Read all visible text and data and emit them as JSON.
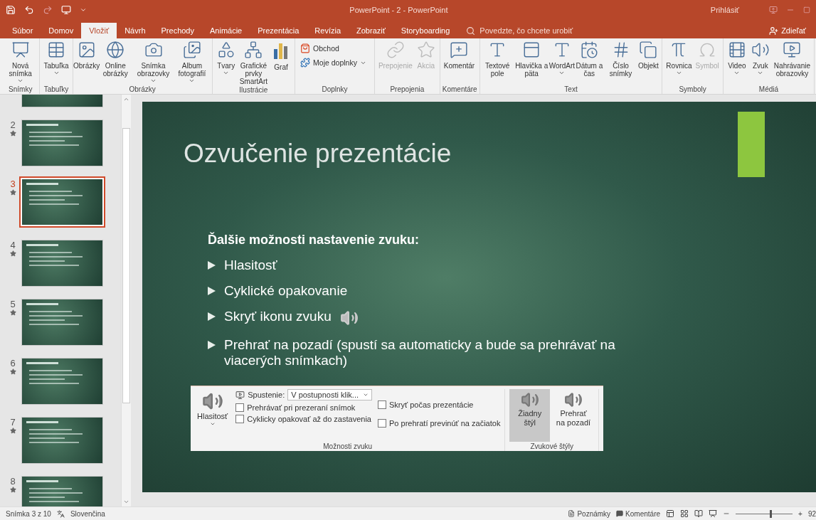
{
  "window": {
    "title": "PowerPoint - 2  -  PowerPoint",
    "sign_in": "Prihlásiť"
  },
  "tabs": [
    {
      "label": "Súbor",
      "selected": false
    },
    {
      "label": "Domov",
      "selected": false
    },
    {
      "label": "Vložiť",
      "selected": true
    },
    {
      "label": "Návrh",
      "selected": false
    },
    {
      "label": "Prechody",
      "selected": false
    },
    {
      "label": "Animácie",
      "selected": false
    },
    {
      "label": "Prezentácia",
      "selected": false
    },
    {
      "label": "Revízia",
      "selected": false
    },
    {
      "label": "Zobraziť",
      "selected": false
    },
    {
      "label": "Storyboarding",
      "selected": false
    }
  ],
  "tell_me": {
    "placeholder": "Povedzte, čo chcete urobiť"
  },
  "share": "Zdieľať",
  "ribbon": [
    {
      "label": "Snímky",
      "buttons": [
        {
          "label": "Nová snímka",
          "kind": "large",
          "dropdown": true,
          "disabled": false
        }
      ]
    },
    {
      "label": "Tabuľky",
      "buttons": [
        {
          "label": "Tabuľka",
          "kind": "large",
          "dropdown": true,
          "disabled": false
        }
      ]
    },
    {
      "label": "Obrázky",
      "buttons": [
        {
          "label": "Obrázky",
          "kind": "large",
          "dropdown": false,
          "disabled": false
        },
        {
          "label": "Online obrázky",
          "kind": "large",
          "dropdown": false,
          "disabled": false
        },
        {
          "label": "Snímka obrazovky",
          "kind": "large",
          "dropdown": true,
          "disabled": false
        },
        {
          "label": "Album fotografií",
          "kind": "large",
          "dropdown": true,
          "disabled": false
        }
      ]
    },
    {
      "label": "Ilustrácie",
      "buttons": [
        {
          "label": "Tvary",
          "kind": "large",
          "dropdown": true,
          "disabled": false
        },
        {
          "label": "Grafické prvky SmartArt",
          "kind": "large",
          "dropdown": false,
          "disabled": false
        },
        {
          "label": "Graf",
          "kind": "large",
          "dropdown": false,
          "disabled": false
        }
      ]
    },
    {
      "label": "Doplnky",
      "buttons": [
        {
          "label": "Obchod",
          "kind": "small",
          "dropdown": false,
          "disabled": false
        },
        {
          "label": "Moje doplnky",
          "kind": "small",
          "dropdown": true,
          "disabled": false
        }
      ]
    },
    {
      "label": "Prepojenia",
      "buttons": [
        {
          "label": "Prepojenie",
          "kind": "large",
          "dropdown": false,
          "disabled": true
        },
        {
          "label": "Akcia",
          "kind": "large",
          "dropdown": false,
          "disabled": true
        }
      ]
    },
    {
      "label": "Komentáre",
      "buttons": [
        {
          "label": "Komentár",
          "kind": "large",
          "dropdown": false,
          "disabled": false
        }
      ]
    },
    {
      "label": "Text",
      "buttons": [
        {
          "label": "Textové pole",
          "kind": "large",
          "dropdown": false,
          "disabled": false
        },
        {
          "label": "Hlavička a päta",
          "kind": "large",
          "dropdown": false,
          "disabled": false
        },
        {
          "label": "WordArt",
          "kind": "large",
          "dropdown": true,
          "disabled": false
        },
        {
          "label": "Dátum a čas",
          "kind": "large",
          "dropdown": false,
          "disabled": false
        },
        {
          "label": "Číslo snímky",
          "kind": "large",
          "dropdown": false,
          "disabled": false
        },
        {
          "label": "Objekt",
          "kind": "large",
          "dropdown": false,
          "disabled": false
        }
      ]
    },
    {
      "label": "Symboly",
      "buttons": [
        {
          "label": "Rovnica",
          "kind": "large",
          "dropdown": true,
          "disabled": false
        },
        {
          "label": "Symbol",
          "kind": "large",
          "dropdown": false,
          "disabled": true
        }
      ]
    },
    {
      "label": "Médiá",
      "buttons": [
        {
          "label": "Video",
          "kind": "large",
          "dropdown": true,
          "disabled": false
        },
        {
          "label": "Zvuk",
          "kind": "large",
          "dropdown": true,
          "disabled": false
        },
        {
          "label": "Nahrávanie obrazovky",
          "kind": "large",
          "dropdown": false,
          "disabled": false
        }
      ]
    }
  ],
  "thumbnails": [
    {
      "kind": "cut",
      "selected": false
    },
    {
      "kind": "slide",
      "number": "2",
      "selected": false
    },
    {
      "kind": "slide",
      "number": "3",
      "selected": true
    },
    {
      "kind": "slide",
      "number": "4",
      "selected": false
    },
    {
      "kind": "slide",
      "number": "5",
      "selected": false
    },
    {
      "kind": "slide",
      "number": "6",
      "selected": false
    },
    {
      "kind": "slide",
      "number": "7",
      "selected": false
    },
    {
      "kind": "slide",
      "number": "8",
      "selected": false
    }
  ],
  "slide": {
    "title": "Ozvučenie prezentácie",
    "heading": "Ďalšie možnosti nastavenie zvuku:",
    "bullets": [
      {
        "text": "Hlasitosť",
        "speaker": false
      },
      {
        "text": "Cyklické opakovanie",
        "speaker": false
      },
      {
        "text": "Skryť ikonu zvuku",
        "speaker": true
      },
      {
        "text": "Prehrať na pozadí (spustí sa automaticky a bude sa prehrávať na viacerých snímkach)",
        "speaker": false
      }
    ],
    "sound_ribbon": {
      "volume": "Hlasitosť",
      "start_label": "Spustenie:",
      "start_value": "V postupnosti klik...",
      "checkboxes": [
        {
          "label": "Prehrávať pri prezeraní snímok",
          "checked": false
        },
        {
          "label": "Cyklicky opakovať až do zastavenia",
          "checked": false
        },
        {
          "label": "Skryť počas prezentácie",
          "checked": false
        },
        {
          "label": "Po prehratí previnúť na začiatok",
          "checked": false
        }
      ],
      "options_label": "Možnosti zvuku",
      "styles": [
        {
          "label": "Žiadny štýl",
          "selected": true
        },
        {
          "label": "Prehrať na pozadí",
          "selected": false
        }
      ],
      "styles_label": "Zvukové štýly"
    }
  },
  "status_bar": {
    "slide": "Snímka 3 z 10",
    "language": "Slovenčina",
    "notes": "Poznámky",
    "comments": "Komentáre",
    "zoom": {
      "level": 0.6
    },
    "zoom_plus": "+",
    "zoom_value": "92"
  }
}
